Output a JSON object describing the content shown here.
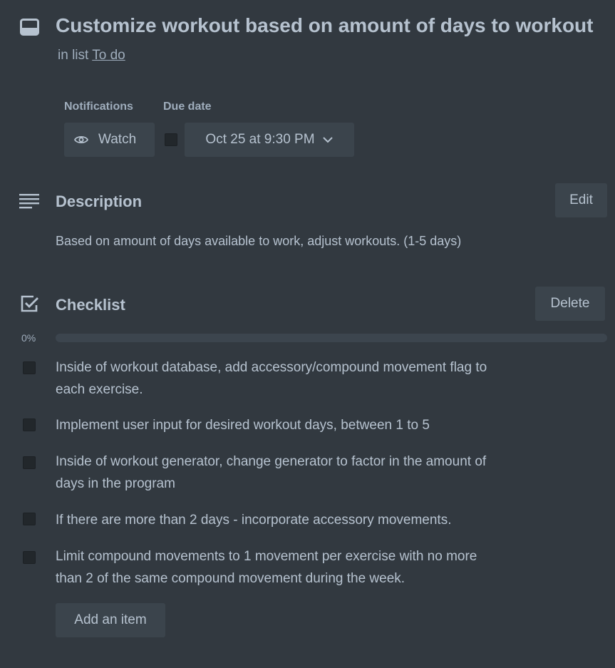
{
  "header": {
    "title": "Customize workout based on amount of days to workout",
    "in_list_prefix": "in list",
    "list_name": "To do"
  },
  "notifications": {
    "label": "Notifications",
    "watch_label": "Watch"
  },
  "due_date": {
    "label": "Due date",
    "value": "Oct 25 at 9:30 PM",
    "checked": false
  },
  "description": {
    "title": "Description",
    "edit_label": "Edit",
    "text": "Based on amount of days available to work, adjust workouts. (1-5 days)"
  },
  "checklist": {
    "title": "Checklist",
    "delete_label": "Delete",
    "progress_text": "0%",
    "progress_fraction": 0,
    "items": [
      {
        "text": "Inside of workout database, add accessory/compound movement flag to each exercise.",
        "checked": false
      },
      {
        "text": "Implement user input for desired workout days, between 1 to 5",
        "checked": false
      },
      {
        "text": "Inside of workout generator, change generator to factor in the amount of days in the program",
        "checked": false
      },
      {
        "text": "If there are more than 2 days - incorporate accessory movements.",
        "checked": false
      },
      {
        "text": "Limit compound movements to 1 movement per exercise with no more than 2 of the same compound movement during the week.",
        "checked": false
      }
    ],
    "add_item_label": "Add an item"
  },
  "colors": {
    "background": "#323940",
    "button": "#3b444c",
    "text": "#b6c2cf",
    "muted_text": "#9fadbc"
  },
  "icons": {
    "card": "card-icon",
    "eye": "eye-icon",
    "chevron": "chevron-down-icon",
    "description": "description-lines-icon",
    "checklist": "checkbox-checked-icon"
  }
}
